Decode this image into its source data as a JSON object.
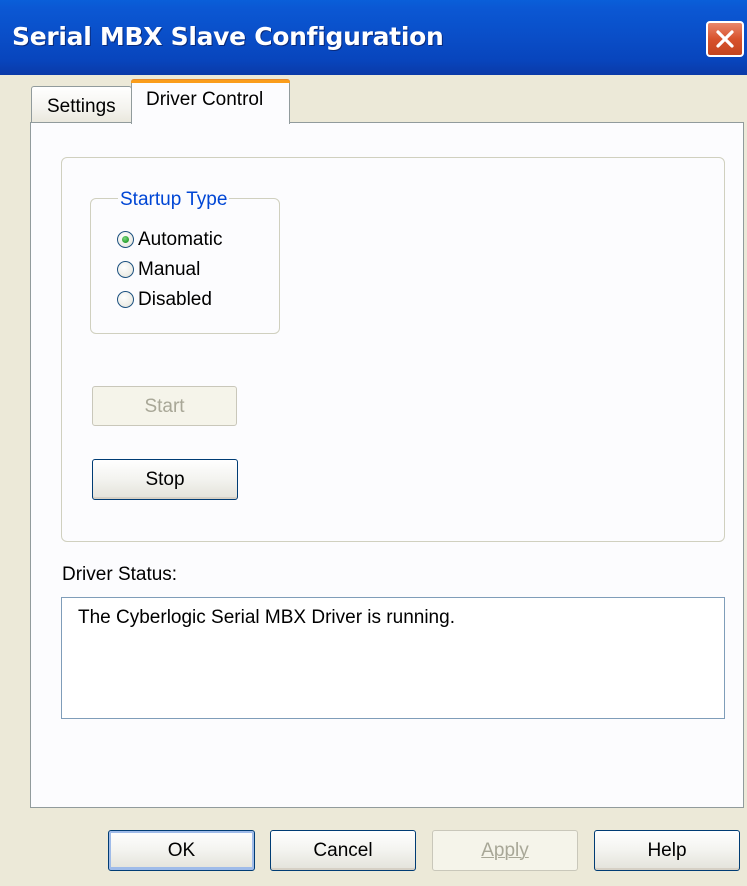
{
  "window": {
    "title": "Serial MBX Slave Configuration"
  },
  "tabs": [
    {
      "label": "Settings",
      "active": false
    },
    {
      "label": "Driver Control",
      "active": true
    }
  ],
  "startup": {
    "legend": "Startup Type",
    "options": [
      {
        "label": "Automatic",
        "selected": true
      },
      {
        "label": "Manual",
        "selected": false
      },
      {
        "label": "Disabled",
        "selected": false
      }
    ]
  },
  "controls": {
    "start_label": "Start",
    "start_enabled": false,
    "stop_label": "Stop",
    "stop_enabled": true
  },
  "status": {
    "label": "Driver Status:",
    "text": "The Cyberlogic Serial MBX Driver is running."
  },
  "footer": {
    "ok_label": "OK",
    "cancel_label": "Cancel",
    "apply_label": "Apply",
    "apply_enabled": false,
    "help_label": "Help"
  },
  "colors": {
    "titlebar": "#0a4fc9",
    "dialog_bg": "#ece9d8",
    "legend_text": "#0046d5",
    "active_tab_highlight": "#fa9d1b",
    "close_button": "#d8522c"
  }
}
